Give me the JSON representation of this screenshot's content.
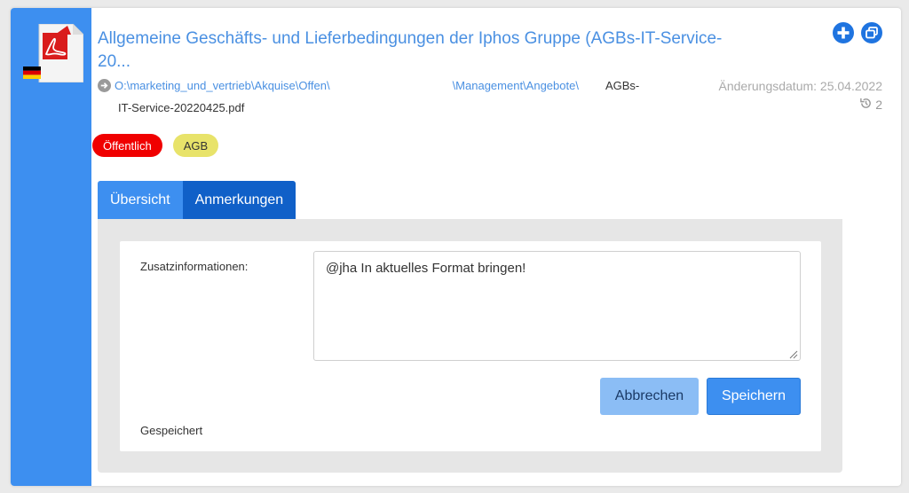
{
  "document": {
    "title": "Allgemeine Geschäfts- und Lieferbedingungen der Iphos Gruppe (AGBs-IT-Service-20...",
    "path_start": "O:\\marketing_und_vertrieb\\Akquise\\Offen\\",
    "path_mid": "\\Management\\Angebote\\",
    "path_file": "AGBs-",
    "filename_rest": "IT-Service-20220425.pdf",
    "changed_label": "Änderungsdatum: 25.04.2022",
    "revision_count": "2",
    "language_flag": "de-flag-icon"
  },
  "tags": [
    {
      "label": "Öffentlich",
      "color": "#f00000"
    },
    {
      "label": "AGB",
      "color": "#e8e36a"
    }
  ],
  "tabs": [
    {
      "label": "Übersicht"
    },
    {
      "label": "Anmerkungen"
    }
  ],
  "notes": {
    "label": "Zusatzinformationen:",
    "value": "@jha In aktuelles Format bringen!",
    "cancel_label": "Abbrechen",
    "save_label": "Speichern",
    "status": "Gespeichert"
  },
  "colors": {
    "accent": "#3d8ff0",
    "accent_dark": "#1060c8",
    "title": "#4a90e2"
  }
}
